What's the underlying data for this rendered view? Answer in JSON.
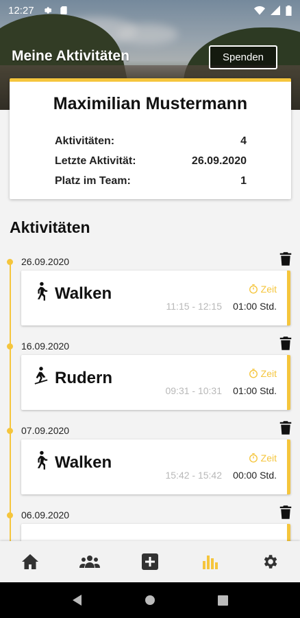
{
  "status_bar": {
    "time": "12:27"
  },
  "header": {
    "title": "Meine Aktivitäten",
    "donate_label": "Spenden"
  },
  "profile": {
    "name": "Maximilian Mustermann",
    "stats": [
      {
        "label": "Aktivitäten:",
        "value": "4"
      },
      {
        "label": "Letzte Aktivität:",
        "value": "26.09.2020"
      },
      {
        "label": "Platz im Team:",
        "value": "1"
      }
    ]
  },
  "activities_section": {
    "title": "Aktivitäten",
    "time_label": "Zeit",
    "entries": [
      {
        "date": "26.09.2020",
        "name": "Walken",
        "icon": "walking-icon",
        "time_range": "11:15 - 12:15",
        "duration": "01:00 Std."
      },
      {
        "date": "16.09.2020",
        "name": "Rudern",
        "icon": "rowing-icon",
        "time_range": "09:31 - 10:31",
        "duration": "01:00 Std."
      },
      {
        "date": "07.09.2020",
        "name": "Walken",
        "icon": "walking-icon",
        "time_range": "15:42 - 15:42",
        "duration": "00:00 Std."
      },
      {
        "date": "06.09.2020"
      }
    ]
  },
  "bottom_nav": [
    "home-icon",
    "team-icon",
    "add-icon",
    "statistics-icon",
    "settings-icon"
  ],
  "colors": {
    "accent": "#f5c53c",
    "text": "#111111",
    "muted": "#b8b8b8"
  }
}
